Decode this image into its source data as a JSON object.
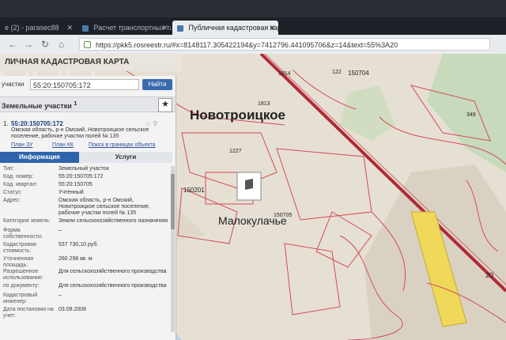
{
  "browser": {
    "tabs": [
      {
        "label": "е (2) - parasec88"
      },
      {
        "label": "Расчет транспортных тари"
      },
      {
        "label": "Публичная кадастровая карта"
      }
    ],
    "url": "https://pkk5.rosreestr.ru/#x=8148117.305422194&y=7412796.441095706&z=14&text=55%3A20"
  },
  "app": {
    "title": "ЛИЧНАЯ КАДАСТРОВАЯ КАРТА",
    "search": {
      "category": "участки",
      "value": "55:20:150705:172",
      "button": "Найти"
    },
    "results_header": "Земельные участки",
    "results_count": "1",
    "result": {
      "num": "1.",
      "title": "55:20:150705:172",
      "address": "Омская область, р-н Омский, Новотроицкое сельское поселение, рабочие участки полей № 135"
    },
    "links": [
      "План ЗУ",
      "План КК",
      "Поиск в границах объекта"
    ],
    "tabs": [
      "Информация",
      "Услуги"
    ],
    "props": [
      {
        "k": "Тип:",
        "v": "Земельный участок"
      },
      {
        "k": "Кад. номер:",
        "v": "55:20:150705:172"
      },
      {
        "k": "Кад. квартал:",
        "v": "55:20:150705"
      },
      {
        "k": "Статус:",
        "v": "Учтенный"
      },
      {
        "k": "Адрес:",
        "v": "Омская область, р-н Омский, Новотроицкое сельское поселение, рабочие участки полей № 135"
      },
      {
        "k": "Категория земель:",
        "v": "Земли сельскохозяйственного назначения"
      },
      {
        "k": "Форма собственности:",
        "v": "–"
      },
      {
        "k": "Кадастровая стоимость:",
        "v": "537 730,10 руб."
      },
      {
        "k": "Уточненная площадь:",
        "v": "260 298 кв. м"
      },
      {
        "k": "Разрешенное использование:",
        "v": "Для сельскохозяйственного производства"
      },
      {
        "k": "по документу:",
        "v": "Для сельскохозяйственного производства"
      },
      {
        "k": "Кадастровый инженер:",
        "v": "–"
      },
      {
        "k": "Дата постановки на учет:",
        "v": "03.09.2008"
      }
    ]
  },
  "map": {
    "place_1": "Новотроицкое",
    "place_2": "Малокулачье",
    "labels": [
      "150704",
      "122",
      "1814",
      "1813",
      "349",
      "1227",
      "150201",
      "20",
      "150705"
    ]
  },
  "colors": {
    "parcel_line": "#d54a5a",
    "road": "#b02a36",
    "highlight": "#f0d85a",
    "panel_tab": "#2f64ac"
  }
}
